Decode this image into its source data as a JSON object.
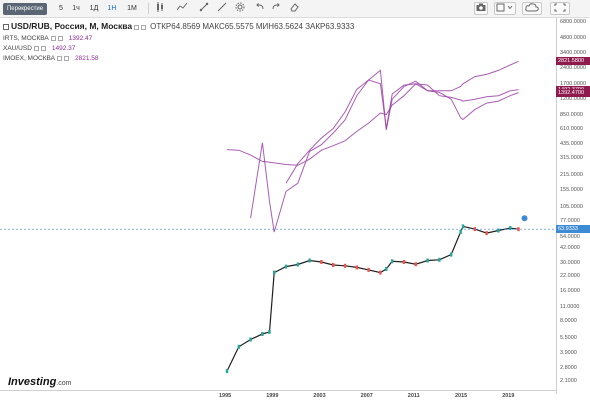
{
  "toolbar": {
    "crosshair": "Перекрестие",
    "intervals": [
      "5",
      "1ч",
      "1Д",
      "1Н",
      "1М"
    ],
    "active_interval": "1Н"
  },
  "legend": {
    "title": "USD/RUB, Россия, М, Москва",
    "ohlc": "ОТКР64.8569  МАКС65.5575  МИН63.5624  ЗАКР63.9333",
    "overlays": [
      {
        "name": "IRTS, МОСКВА",
        "value": "1392.47"
      },
      {
        "name": "XAU/USD",
        "value": "1492.37"
      },
      {
        "name": "IMOEX, МОСКВА",
        "value": "2821.58"
      }
    ]
  },
  "logo": {
    "main": "Investing",
    "suffix": ".com"
  },
  "colors": {
    "candle_up": "#26a69a",
    "candle_down": "#ef5350",
    "overlay": "#9b3fa8",
    "accent": "#1a6dc9",
    "tag_overlay": "#8e1a4e",
    "tag_main": "#3d8bd4"
  },
  "chart_data": {
    "type": "line",
    "scale": "log",
    "grid": false,
    "legend_position": "top-left",
    "title": "USD/RUB, Россия, М, Москва",
    "x": [
      1995,
      1996,
      1997,
      1998,
      1998.6,
      1999,
      2000,
      2001,
      2002,
      2003,
      2004,
      2005,
      2006,
      2007,
      2008,
      2008.5,
      2009,
      2010,
      2011,
      2012,
      2013,
      2014,
      2014.8,
      2015,
      2016,
      2017,
      2018,
      2019,
      2019.7
    ],
    "xticks": [
      "1995",
      "1999",
      "2003",
      "2007",
      "2011",
      "2015",
      "2019"
    ],
    "ylim": [
      1.9,
      7500
    ],
    "yticks": [
      "6800.0000",
      "4800.0000",
      "3400.0000",
      "2400.0000",
      "1700.0000",
      "1200.0000",
      "850.0000",
      "610.0000",
      "435.0000",
      "315.0000",
      "215.0000",
      "155.0000",
      "105.0000",
      "77.0000",
      "54.0000",
      "42.0000",
      "30.0000",
      "22.0000",
      "16.0000",
      "11.0000",
      "8.0000",
      "5.5000",
      "3.9000",
      "2.8000",
      "2.1000"
    ],
    "price_tags": [
      {
        "label": "2821.5800",
        "value": 2821.58,
        "series": "IMOEX, МОСКВА"
      },
      {
        "label": "1492.3700",
        "value": 1492.37,
        "series": "XAU/USD"
      },
      {
        "label": "1392.4700",
        "value": 1392.47,
        "series": "IRTS, МОСКВА"
      },
      {
        "label": "63.9333",
        "value": 63.9333,
        "series": "USD/RUB"
      }
    ],
    "series": [
      {
        "name": "USD/RUB",
        "values": [
          2.6,
          4.5,
          5.3,
          6.0,
          6.3,
          24.0,
          27.5,
          28.8,
          31.5,
          30.5,
          28.5,
          28.0,
          27.0,
          25.5,
          24.0,
          26.0,
          31.0,
          30.5,
          29.0,
          31.5,
          32.0,
          36.0,
          60.0,
          68.0,
          64.0,
          58.5,
          62.0,
          65.5,
          63.93
        ]
      },
      {
        "name": "IRTS, МОСКВА",
        "values": [
          null,
          null,
          82,
          450,
          120,
          60,
          150,
          180,
          370,
          430,
          560,
          750,
          1300,
          1850,
          2300,
          600,
          1200,
          1600,
          1800,
          1450,
          1400,
          1200,
          790,
          760,
          950,
          1100,
          1150,
          1300,
          1392.47
        ]
      },
      {
        "name": "XAU/USD",
        "values": [
          385,
          380,
          340,
          295,
          290,
          285,
          275,
          270,
          310,
          380,
          420,
          470,
          580,
          700,
          880,
          850,
          1050,
          1300,
          1700,
          1650,
          1300,
          1250,
          1180,
          1150,
          1200,
          1270,
          1300,
          1450,
          1492.37
        ]
      },
      {
        "name": "IMOEX, МОСКВА",
        "values": [
          null,
          null,
          null,
          null,
          null,
          null,
          180,
          280,
          380,
          500,
          620,
          900,
          1500,
          1850,
          1700,
          620,
          1350,
          1650,
          1700,
          1450,
          1450,
          1450,
          1600,
          1700,
          2000,
          2100,
          2300,
          2600,
          2821.58
        ]
      }
    ]
  }
}
